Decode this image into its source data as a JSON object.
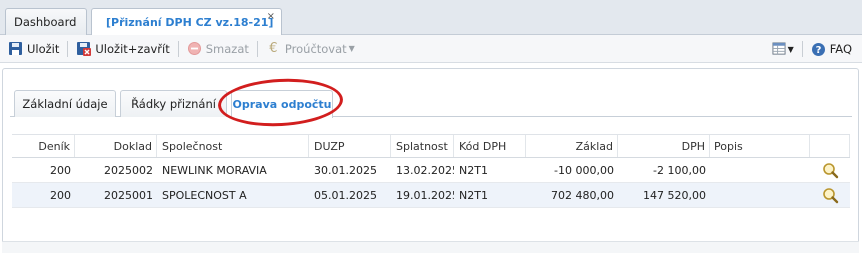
{
  "doc_tabs": {
    "dashboard": "Dashboard",
    "active": "[Přiznání DPH CZ vz.18-21]",
    "close": "×"
  },
  "toolbar": {
    "save": "Uložit",
    "save_close": "Uložit+zavřít",
    "delete": "Smazat",
    "post": "Proúčtovat",
    "faq": "FAQ"
  },
  "inner_tabs": [
    "Základní údaje",
    "Řádky přiznání",
    "Oprava odpočtu"
  ],
  "grid": {
    "columns": [
      "Deník",
      "Doklad",
      "Společnost",
      "DUZP",
      "Splatnost",
      "Kód DPH",
      "Základ",
      "DPH",
      "Popis"
    ],
    "rows": [
      {
        "denik": "200",
        "doklad": "2025002",
        "spolecnost": "NEWLINK MORAVIA",
        "duzp": "30.01.2025",
        "splatnost": "13.02.2025",
        "kod": "N2T1",
        "zaklad": "-10 000,00",
        "dph": "-2 100,00",
        "popis": ""
      },
      {
        "denik": "200",
        "doklad": "2025001",
        "spolecnost": "SPOLECNOST A",
        "duzp": "05.01.2025",
        "splatnost": "19.01.2025",
        "kod": "N2T1",
        "zaklad": "702 480,00",
        "dph": "147 520,00",
        "popis": ""
      }
    ]
  },
  "colors": {
    "accent": "#2d7fd0",
    "highlight_ring": "#d21e1e",
    "row_alt": "#eef3fa"
  }
}
